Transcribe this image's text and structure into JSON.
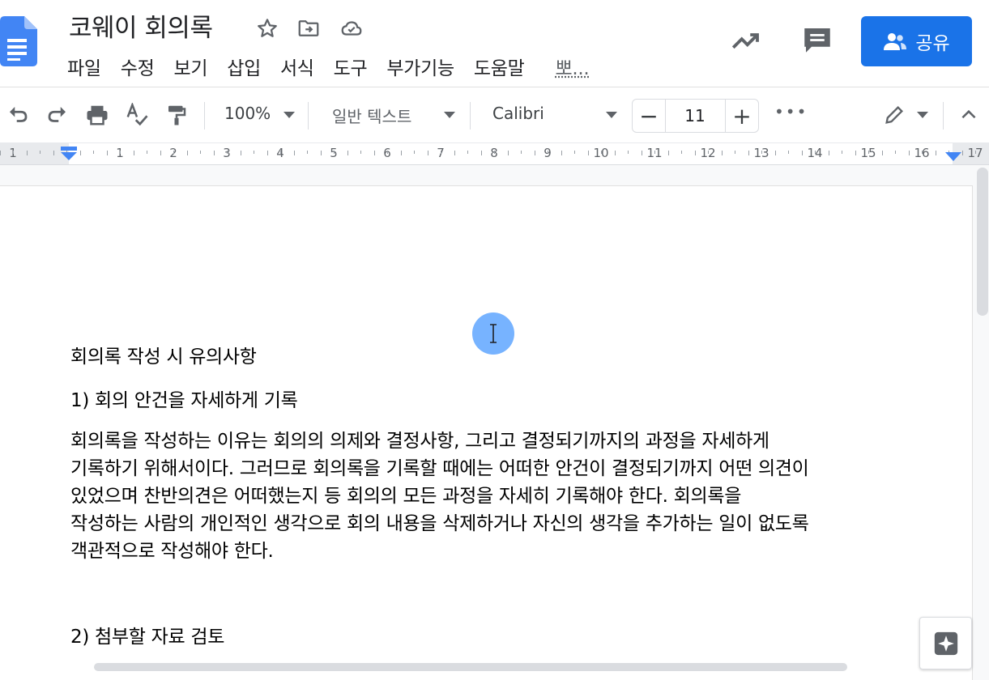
{
  "doc": {
    "title": "코웨이 회의록"
  },
  "menu": [
    "파일",
    "수정",
    "보기",
    "삽입",
    "서식",
    "도구",
    "부가기능",
    "도움말",
    "뽀..."
  ],
  "share": {
    "label": "공유"
  },
  "toolbar": {
    "zoom": "100%",
    "style": "일반 텍스트",
    "font": "Calibri",
    "font_size": "11",
    "minus": "−",
    "plus": "+",
    "more": "•••"
  },
  "ruler": {
    "labels": [
      "1",
      "1",
      "2",
      "3",
      "4",
      "5",
      "6",
      "7",
      "8",
      "9",
      "10",
      "11",
      "12",
      "13",
      "14",
      "15",
      "16",
      "17"
    ]
  },
  "document": {
    "heading": "회의록 작성 시 유의사항",
    "item1": "1) 회의 안건을 자세하게 기록",
    "para_lines": [
      "회의록을 작성하는 이유는 회의의 의제와 결정사항, 그리고 결정되기까지의 과정을 자세하게",
      "기록하기 위해서이다. 그러므로 회의록을 기록할 때에는 어떠한 안건이 결정되기까지 어떤 의견이",
      "있었으며 찬반의견은 어떠했는지 등 회의의 모든 과정을 자세히 기록해야 한다. 회의록을",
      "작성하는 사람의 개인적인 생각으로 회의 내용을 삭제하거나 자신의 생각을 추가하는 일이 없도록",
      "객관적으로 작성해야 한다."
    ],
    "item2": "2) 첨부할 자료 검토"
  },
  "colors": {
    "accent": "#1a73e8",
    "docs_blue": "#4285f4",
    "cursor_bubble": "#4296ff"
  },
  "icons": [
    "docs-logo-icon",
    "star-icon",
    "move-to-folder-icon",
    "cloud-saved-icon",
    "activity-trend-icon",
    "comments-icon",
    "share-person-icon",
    "undo-icon",
    "redo-icon",
    "print-icon",
    "spellcheck-icon",
    "paint-format-icon",
    "edit-mode-pencil-icon",
    "collapse-chevron-icon",
    "explore-icon",
    "text-cursor-icon"
  ]
}
